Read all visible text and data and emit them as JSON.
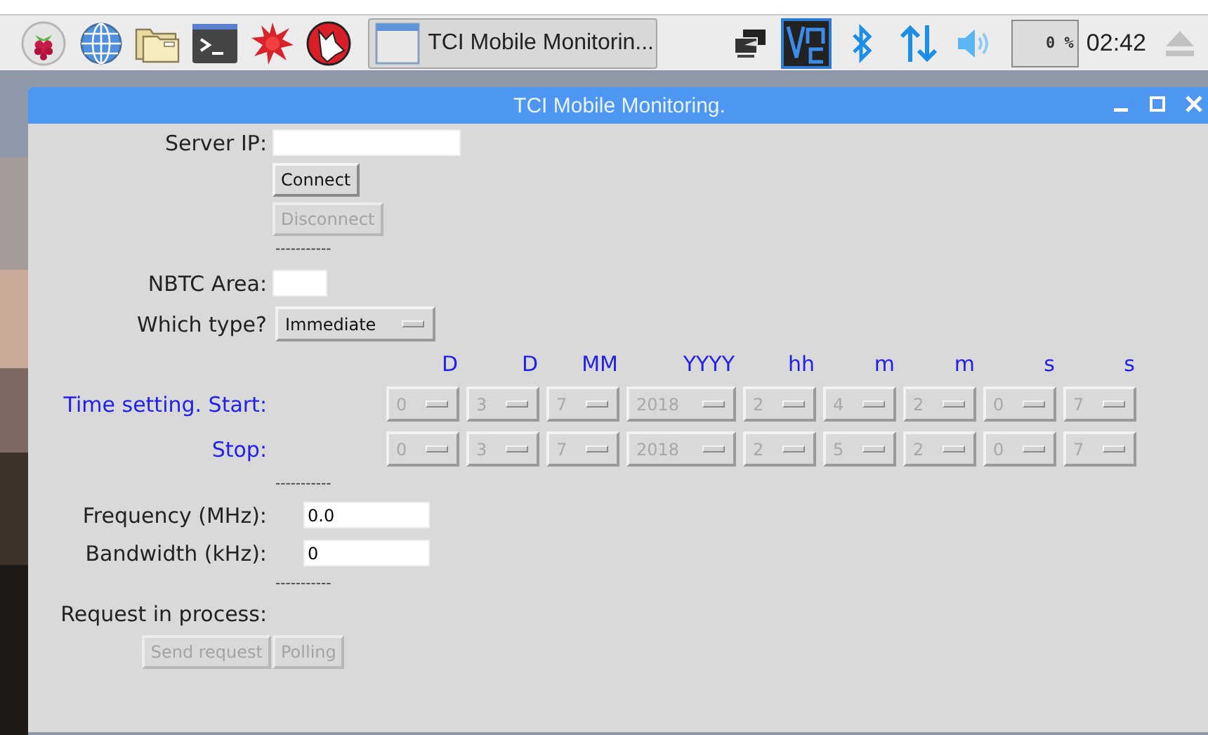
{
  "taskbar": {
    "task_button": {
      "title": "TCI Mobile Monitorin...",
      "selected": true
    },
    "cpu_monitor": "0 %",
    "clock": "02:42"
  },
  "window": {
    "title": "TCI Mobile Monitoring."
  },
  "form": {
    "server_ip": {
      "label": "Server IP:"
    },
    "connection_buttons": [
      {
        "label": "Connect",
        "disabled": false
      },
      {
        "label": "Disconnect",
        "disabled": true
      }
    ],
    "separator_1": "-----------",
    "nbtc_area": {
      "label": "NBTC Area:"
    },
    "which_type": {
      "label": "Which type?",
      "value": "Immediate"
    },
    "time_setting": {
      "headers": [
        "D",
        "D",
        "MM",
        "YYYY",
        "hh",
        "m",
        "m",
        "s",
        "s"
      ],
      "rows": [
        {
          "label": "Time setting. Start:",
          "disabled": true,
          "values": [
            "0",
            "3",
            "7",
            "2018",
            "2",
            "4",
            "2",
            "0",
            "7"
          ]
        },
        {
          "label": "Stop:",
          "disabled": true,
          "values": [
            "0",
            "3",
            "7",
            "2018",
            "2",
            "5",
            "2",
            "0",
            "7"
          ]
        }
      ]
    },
    "separator_2": "-----------",
    "frequency": {
      "label": "Frequency (MHz):",
      "value": "0.0"
    },
    "bandwidth": {
      "label": "Bandwidth (kHz):",
      "value": "0"
    },
    "separator_3": "-----------",
    "request": {
      "label": "Request in process:",
      "buttons": [
        {
          "label": "Send request",
          "disabled": true
        },
        {
          "label": "Polling",
          "disabled": true
        }
      ]
    }
  }
}
